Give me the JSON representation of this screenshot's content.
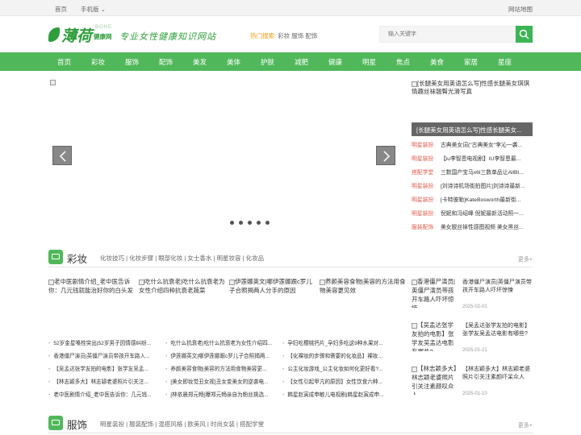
{
  "topbar": {
    "home": "首页",
    "mobile": "手机版",
    "mobile_arrow": "⌄",
    "sitemap": "网站地图"
  },
  "header": {
    "logo_cn": "薄荷",
    "logo_en": "BOHE",
    "logo_sub": "健康网",
    "slogan": "专业女性健康知识网站",
    "hot_label": "热门搜索:",
    "hot_words": "彩妆 服饰 配饰",
    "search_placeholder": "输入关键字"
  },
  "nav": [
    "首页",
    "彩妆",
    "服饰",
    "配饰",
    "美发",
    "美体",
    "护肤",
    "减肥",
    "健康",
    "明星",
    "焦点",
    "美食",
    "家居",
    "星座"
  ],
  "side": {
    "image_alt": "[长腿美女用英语怎么写]性感长腿美女琪琪情趣丝袜翘臀光滑写真",
    "caption": "[长腿美女用英语怎么写]性感长腿美女...",
    "items": [
      {
        "cat": "明星装扮",
        "title": "古典美女词(\"古典美女\"李沁一袭..."
      },
      {
        "cat": "明星装扮",
        "title": "【iu李智恩电视剧】IU李智恩最..."
      },
      {
        "cat": "搭配学堂",
        "title": "三数国产宝马x6l三数单品让AllBl..."
      },
      {
        "cat": "明星装扮",
        "title": "[刘诗诗机场街拍图片]刘诗诗最新..."
      },
      {
        "cat": "明星装扮",
        "title": "[卡特彼勒]KateBosworth最新街..."
      },
      {
        "cat": "明星装扮",
        "title": "倪妮和冯绍峰 倪妮最新活动照一..."
      },
      {
        "cat": "服装配饰",
        "title": "美女脱丝袜性感图视频 美女黑丝..."
      }
    ]
  },
  "makeup": {
    "title": "彩妆",
    "subs": "化妆技巧 | 化妆步骤 | 眼部化妆 | 女士香水 | 明星妆容 | 化妆品",
    "more": "更多+",
    "thumbs": [
      "老中医剧情介绍_老中医告诉你：几元钱就能治好你的白头发",
      "吃什么抗衰老|吃什么抗衰老为女性介绍四种抗衰老蔬菜",
      "伊莲娜英文|哪伊莲娜跟c罗儿子合照揭两人分手的原因",
      "养颜美容食物|美容的方法用食物美容更见效"
    ],
    "col1": [
      "52岁金星嗓栓突出|52岁男子因情感纠纷...",
      "香港僵尸演员|英僵尸演员带孩开车路人...",
      "【吴孟达张学友拍的电影】张学友吴孟...",
      "【林志颖多大】林志颖老婆照片引关注...",
      "老中医剧情介绍_老中医告诉你：几元钱..."
    ],
    "col2": [
      "吃什么抗衰老|吃什么抗衰老为女性介绍四...",
      "伊莲娜英文|哪伊莲娜跟c罗儿子合照揭两...",
      "养颜美容食物|美容的方法用食物美容更...",
      "[美女即妆觉丑女视]丑女变美女的逆袭电...",
      "[林依晨郑元畅]曝郑元畅亲自为粉丝挑选..."
    ],
    "col3": [
      "孕妇吃樱桃钙片_孕妇多吃这9种水果对...",
      "【化裸妆的步骤和需要的化妆品】裸妆...",
      "公主化妆游戏_公主化妆如何化更好看?...",
      "【女性引起甲亢的原因】女性饮食六种...",
      "韩星赵寅成申敏儿电视剧|韩星赵寅成申..."
    ],
    "cards": [
      {
        "img": "香港僵尸演员|英僵尸演员带孩开车路人吓坏惊悚",
        "text": "香港僵尸演员|英僵尸演员带孩开车路人吓坏惊悚",
        "date": "2025-02-01"
      },
      {
        "img": "【吴孟达张学友拍的电影】张学友吴孟达电影有哪些?",
        "text": "【吴孟达张学友拍的电影】张学友吴孟达电影有哪些?",
        "date": "2025-01-21"
      },
      {
        "img": "【林志颖多大】林志颖老婆照片引关注素颜叹众人",
        "text": "【林志颖多大】林志颖老婆照片引关注素颜吓呆众人",
        "date": "2025-01-10"
      }
    ]
  },
  "fashion": {
    "title": "服饰",
    "subs": "明星装扮 | 服装配饰 | 混搭风格 | 欧美风 | 时尚女装 | 搭配学堂",
    "more": "更多+"
  },
  "colors": {
    "brand": "#50b85a",
    "accent": "#e45a4b",
    "hot": "#f39c12"
  }
}
